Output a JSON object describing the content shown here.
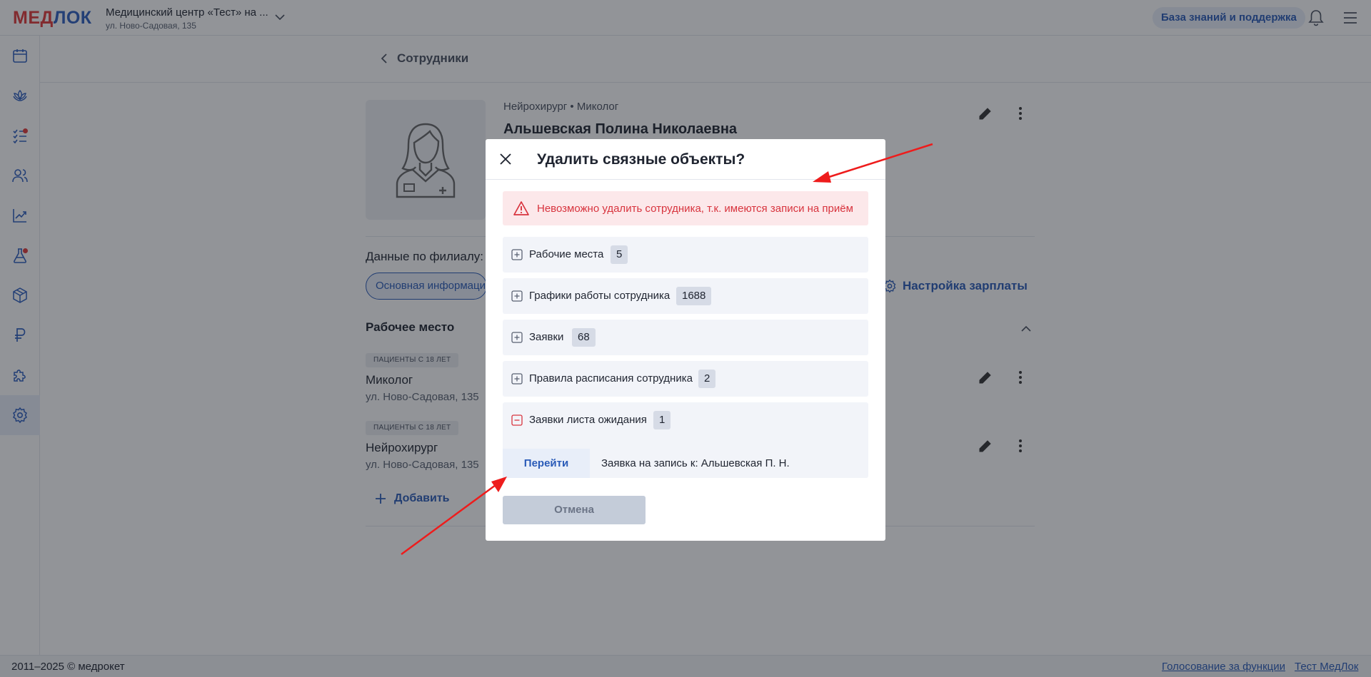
{
  "header": {
    "logo_part1": "МЕД",
    "logo_part2": "ЛОК",
    "clinic_name": "Медицинский центр «Тест» на ...",
    "clinic_address": "ул. Ново-Садовая, 135",
    "knowledge_base_label": "База знаний и поддержка"
  },
  "sidebar": {
    "items": [
      {
        "icon": "calendar-icon"
      },
      {
        "icon": "lotus-icon"
      },
      {
        "icon": "tasks-icon",
        "has_dot": true
      },
      {
        "icon": "users-icon"
      },
      {
        "icon": "chart-icon"
      },
      {
        "icon": "flask-icon",
        "has_dot": true
      },
      {
        "icon": "box-icon"
      },
      {
        "icon": "ruble-icon"
      },
      {
        "icon": "puzzle-icon"
      },
      {
        "icon": "settings-icon",
        "active": true
      }
    ]
  },
  "page": {
    "back_label": "Сотрудники",
    "specialty": "Нейрохирург • Миколог",
    "full_name": "Альшевская Полина Николаевна",
    "branch_label": "Данные по филиалу: М",
    "tab_main": "Основная информация",
    "salary_label": "Настройка зарплаты",
    "workplace_title": "Рабочее место",
    "workplaces": [
      {
        "badge": "ПАЦИЕНТЫ С 18 ЛЕТ",
        "name": "Миколог",
        "address": "ул. Ново-Садовая, 135"
      },
      {
        "badge": "ПАЦИЕНТЫ С 18 ЛЕТ",
        "name": "Нейрохирург",
        "address": "ул. Ново-Садовая, 135"
      }
    ],
    "add_label": "Добавить"
  },
  "footer": {
    "copyright": "2011–2025 © медрокет",
    "link_vote": "Голосование за функции",
    "link_test": "Тест МедЛок"
  },
  "modal": {
    "title": "Удалить связные объекты?",
    "alert_text": "Невозможно удалить сотрудника, т.к. имеются записи на приём",
    "rows": [
      {
        "label": "Рабочие места",
        "count": "5"
      },
      {
        "label": "Графики работы сотрудника",
        "count": "1688"
      },
      {
        "label": "Заявки",
        "count": "68"
      },
      {
        "label": "Правила расписания сотрудника",
        "count": "2"
      },
      {
        "label": "Заявки листа ожидания",
        "count": "1",
        "expanded": true
      }
    ],
    "goto_label": "Перейти",
    "goto_text": "Заявка на запись к: Альшевская П. Н.",
    "cancel_label": "Отмена"
  },
  "colors": {
    "brand_blue": "#2a5bb8",
    "brand_red": "#e03a3a",
    "alert_text": "#d8343e",
    "annotation_arrow": "#ee1c1c"
  }
}
